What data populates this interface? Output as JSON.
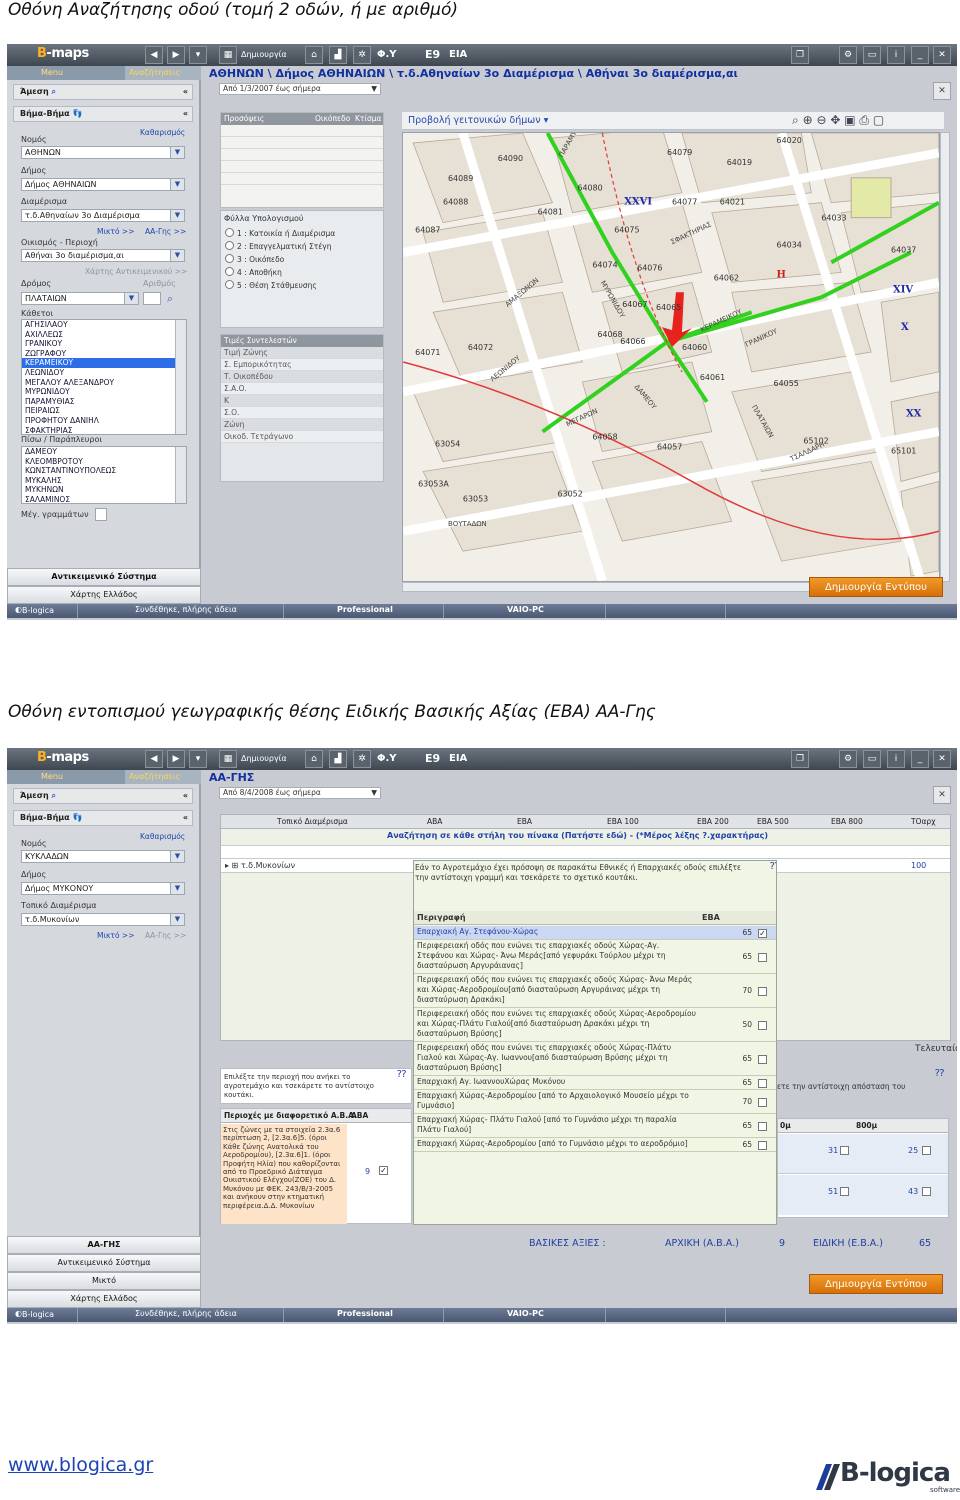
{
  "captions": {
    "top": "Οθόνη Αναζήτησης οδού (τομή 2 οδών, ή με αριθμό)",
    "middle": "Οθόνη εντοπισμού γεωγραφικής θέσης Ειδικής Βασικής Αξίας (ΕΒΑ) ΑΑ-Γης"
  },
  "app": {
    "logo": "B-maps",
    "logo_prefix": "B",
    "logo_suffix": "-maps",
    "toolbar": {
      "print_label": "Δημιουργία",
      "fy": "Φ.Υ",
      "e9": "Ε9",
      "eia": "ΕΙΑ"
    },
    "menu_tabs": {
      "menu": "Menu",
      "search": "Αναζήτησεις"
    },
    "status": {
      "company": "B-logica",
      "connection": "Συνδέθηκε, πλήρης άδεια",
      "edition": "Professional",
      "machine": "VAIO-PC"
    },
    "create_print_button": "Δημιουργία Εντύπου"
  },
  "screen1": {
    "breadcrumb": "ΑΘΗΝΩΝ \\ Δήμος ΑΘΗΝΑΙΩΝ \\ τ.δ.Αθηναίων 3ο Διαμέρισμα \\ Αθήναι 3ο διαμέρισμα,αι",
    "date_range": "Από 1/3/2007 έως σήμερα",
    "direct_label": "Άμεση",
    "step_label": "Βήμα-Βήμα",
    "clear_link": "Καθαρισμός",
    "nomos_label": "Νομός",
    "nomos_value": "ΑΘΗΝΩΝ",
    "dimos_label": "Δήμος",
    "dimos_value": "Δήμος ΑΘΗΝΑΙΩΝ",
    "diamerisma_label": "Διαμέρισμα",
    "diamerisma_value": "τ.δ.Αθηναίων 3ο Διαμέρισμα",
    "mixto_link": "Μικτό >>",
    "aagis_link": "ΑΑ-Γης >>",
    "oikismos_label": "Οικισμός - Περιοχή",
    "oikismos_value": "Αθήναι 3ο διαμέρισμα,αι",
    "objects_map_link": "Χάρτης Αντικειμενικού >>",
    "street_label": "Δρόμος",
    "number_label": "Αριθμός",
    "street_value": "ΠΛΑΤΑΙΩΝ",
    "cross_label": "Κάθετοι",
    "cross_streets": [
      "ΑΓΗΣΙΛΑΟΥ",
      "ΑΧΙΛΛΕΩΣ",
      "ΓΡΑΝΙΚΟΥ",
      "ΖΩΓΡΑΦΟΥ",
      "ΚΕΡΑΜΕΙΚΟΥ",
      "ΛΕΩΝΙΔΟΥ",
      "ΜΕΓΑΛΟΥ ΑΛΕΞΑΝΔΡΟΥ",
      "ΜΥΡΩΝΙΔΟΥ",
      "ΠΑΡΑΜΥΘΙΑΣ",
      "ΠΕΙΡΑΙΩΣ",
      "ΠΡΟΦΗΤΟΥ ΔΑΝΙΗΛ",
      "ΣΦΑΚΤΗΡΙΑΣ"
    ],
    "back_label": "Πίσω / Παράπλευροι",
    "back_streets": [
      "ΔΑΜΕΟΥ",
      "ΚΛΕΟΜΒΡΟΤΟΥ",
      "ΚΩΝΣΤΑΝΤΙΝΟΥΠΟΛΕΩΣ",
      "ΜΥΚΑΛΗΣ",
      "ΜΥΚΗΝΩΝ",
      "ΣΑΛΑΜΙΝΟΣ"
    ],
    "letter_size": "Μέγ. γραμμάτων",
    "bottom_buttons": {
      "objective": "Αντικειμενικό Σύστημα",
      "greece_map": "Χάρτης Ελλάδος"
    },
    "prices_table": {
      "h1": "Προσόψεις",
      "h2": "Οικόπεδο",
      "h3": "Κτίσμα"
    },
    "calc_sheets": {
      "title": "Φύλλα Υπολογισμού",
      "items": [
        "1 : Κατοικία ή Διαμέρισμα",
        "2 : Επαγγελματική Στέγη",
        "3 : Οικόπεδο",
        "4 : Αποθήκη",
        "5 : Θέση Στάθμευσης"
      ]
    },
    "coef_table": {
      "title": "Τιμές Συντελεστών",
      "rows": [
        "Τιμή Ζώνης",
        "Σ. Εμπορικότητας",
        "Τ. Οικοπέδου",
        "Σ.Α.Ο.",
        "Κ",
        "Σ.Ο.",
        "Ζώνη",
        "Οικοδ. Τετράγωνο"
      ]
    },
    "map_toolbar": "Προβολή γειτονικών δήμων",
    "map_blocks": [
      "64090",
      "64079",
      "64019",
      "64020",
      "64089",
      "64080",
      "64088",
      "64077",
      "64021",
      "64033",
      "64081",
      "64075",
      "64087",
      "64034",
      "64074",
      "64076",
      "64037",
      "64062",
      "64072",
      "64068",
      "64066",
      "64060",
      "64071",
      "64061",
      "64055",
      "64065",
      "64058",
      "65102",
      "64057",
      "63054",
      "65101",
      "63053",
      "63053Α",
      "63052",
      "64067"
    ],
    "map_streets": [
      "ΠΑΡΑΜΥΘΙΑΣ",
      "ΣΦΑΚΤΗΡΙΑΣ",
      "ΚΕΡΑΜΕΙΚΟΥ",
      "ΓΡΑΝΙΚΟΥ",
      "ΜΥΡΩΝΙΔΟΥ",
      "ΑΜΑΞΩΝΩΝ",
      "ΛΕΩΝΙΔΟΥ",
      "ΜΕΓΑΡΩΝ",
      "ΔΑΜΕΟΥ",
      "ΠΛΑΤΑΙΩΝ",
      "ΒΟΥΤΑΔΩΝ",
      "ΤΣΑΛΔΑΡΗ"
    ],
    "map_zone_labels": [
      "XXVI",
      "XIV",
      "H",
      "X",
      "XX"
    ]
  },
  "screen2": {
    "breadcrumb": "ΑΑ-ΓΗΣ",
    "date_range": "Από 8/4/2008 έως σήμερα",
    "direct_label": "Άμεση",
    "step_label": "Βήμα-Βήμα",
    "clear_link": "Καθαρισμός",
    "nomos_label": "Νομός",
    "nomos_value": "ΚΥΚΛΑΔΩΝ",
    "dimos_label": "Δήμος",
    "dimos_value": "Δήμος ΜΥΚΟΝΟΥ",
    "diamerisma_label": "Τοπικό Διαμέρισμα",
    "diamerisma_value": "τ.δ.Μυκονίων",
    "mixto_link": "Μικτό >>",
    "aagis_link": "ΑΑ-Γης >>",
    "bottom_buttons": {
      "aagis": "ΑΑ-ΓΗΣ",
      "objective": "Αντικειμενικό Σύστημα",
      "mixto": "Μικτό",
      "greece_map": "Χάρτης Ελλάδος"
    },
    "grid": {
      "headers": [
        "Τοπικό Διαμέρισμα",
        "ΑΒΑ",
        "ΕΒΑ",
        "ΕΒΑ 100",
        "ΕΒΑ 200",
        "ΕΒΑ 500",
        "ΕΒΑ 800",
        "ΤΟαρχ"
      ],
      "search_hint": "Αναζήτηση σε κάθε στήλη του πίνακα (Πατήστε εδώ) - (*Μέρος λέξης ?.χαρακτήρας)",
      "row_label": "τ.δ.Μυκονίων",
      "row_last": "100"
    },
    "popup": {
      "intro": "Εάν το Αγροτεμάχιο έχει πρόσοψη σε παρακάτω Εθνικές ή Επαρχιακές οδούς επιλέξτε την αντίστοιχη γραμμή και τσεκάρετε το σχετικό κουτάκι.",
      "col_desc": "Περιγραφή",
      "col_eba": "ΕΒΑ",
      "rows": [
        {
          "text": "Επαρχιακή Αγ. Στεφάνου-Χώρας",
          "eba": "65",
          "checked": true
        },
        {
          "text": "Περιφερειακή οδός που ενώνει τις επαρχιακές οδούς Χώρας-Αγ. Στεφάνου και Χώρας- Άνω Μεράς[από γεφυράκι Τούρλου μέχρι τη διασταύρωση Αργυράιανας]",
          "eba": "65",
          "checked": false
        },
        {
          "text": "Περιφερειακή οδός που ενώνει τις επαρχιακές οδούς Χώρας- Άνω Μεράς και Χώρας-Αεροδρομίου[από διασταύρωση Αργυράινας μέχρι τη διασταύρωση Δρακάκι]",
          "eba": "70",
          "checked": false
        },
        {
          "text": "Περιφερειακή οδός που ενώνει τις επαρχιακές οδούς Χώρας-Αεροδρομίου και Χώρας-Πλάτυ Γιαλού[από διασταύρωση Δρακάκι μέχρι τη διασταύρωση Βρύσης]",
          "eba": "50",
          "checked": false
        },
        {
          "text": "Περιφερειακή οδός που ενώνει τις επαρχιακές οδούς Χώρας-Πλάτυ Γιαλού και Χώρας-Αγ. Ιωαννου[από διασταύρωση Βρύσης μέχρι τη διασταύρωση Βρύσης]",
          "eba": "65",
          "checked": false
        },
        {
          "text": "Επαρχιακή Αγ. ΙωαννουΧώρας Μυκόνου",
          "eba": "65",
          "checked": false
        },
        {
          "text": "Επαρχιακή Χώρας-Αεροδρομίου [από το Αρχαιολογικό Μουσείο μέχρι το Γυμνάσιο]",
          "eba": "70",
          "checked": false
        },
        {
          "text": "Επαρχιακή Χώρας- Πλάτυ Γιαλού [από το Γυμνάσιο μέχρι τη παραλία Πλάτυ Γιαλού]",
          "eba": "65",
          "checked": false
        },
        {
          "text": "Επαρχιακή Χώρας-Αεροδρομίου [από το Γυμνάσιο μέχρι το αεροδρόμιο]",
          "eba": "65",
          "checked": false
        }
      ]
    },
    "left_note": "Επιλέξτε την περιοχή που ανήκει το αγροτεμάχιο και τσεκάρετε το αντίστοιχο κουτάκι.",
    "right_note": "ετε την αντίστοιχη απόσταση του",
    "finish_label": "Τελευταία Αλλαγ",
    "areas_table": {
      "title": "Περιοχές με διαφορετικό Α.Β.Α.",
      "aba_col": "ΑΒΑ",
      "text": "Στις ζώνες με τα στοιχεία 2.3α.6 περίπτωση 2, [2.3α.6]5. (όροι Κάθε ζώνης Ανατολικά του Αεροδρομίου), [2.3α.6]1. (όροι Προφήτη Ηλία) που καθορίζονται από το Προεδρικό Διάταγμα Οικιστικού Ελέγχου(ΖΟΕ) του Δ. Μυκόνου με ΦΕΚ. 243/Β/3-2005 και ανήκουν στην κτηματική περιφέρεια.Δ.Δ. Μυκονίων",
      "value": "9"
    },
    "dist_table": {
      "h1": "0μ",
      "h2": "800μ",
      "rows": [
        {
          "a": "31",
          "b": "25"
        },
        {
          "a": "51",
          "b": "43"
        }
      ]
    },
    "footer_values": {
      "basic_label": "ΒΑΣΙΚΕΣ ΑΞΙΕΣ :",
      "initial_label": "ΑΡΧΙΚΗ (Α.Β.Α.)",
      "initial_value": "9",
      "special_label": "ΕΙΔΙΚΗ (Ε.Β.Α.)",
      "special_value": "65"
    }
  },
  "footer": {
    "url": "www.blogica.gr",
    "logo": "B-logica",
    "logo_sub": "software"
  },
  "colors": {
    "accent_orange": "#e2800f",
    "highlight_blue": "#2d6ee8",
    "route_green": "#33d11f",
    "title_blue": "#1230a0"
  }
}
